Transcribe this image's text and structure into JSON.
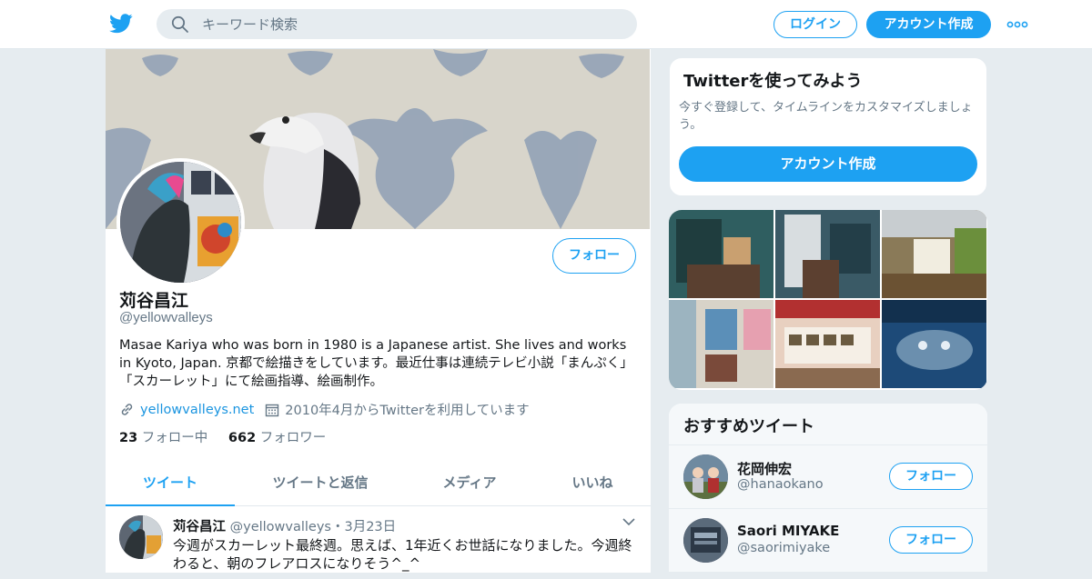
{
  "header": {
    "logo_icon": "twitter-bird-icon",
    "search_placeholder": "キーワード検索",
    "login_label": "ログイン",
    "signup_label": "アカウント作成",
    "more_icon": "more-dots-icon",
    "brand_color": "#1da1f2"
  },
  "profile": {
    "name": "苅谷昌江",
    "handle": "@yellowvalleys",
    "follow_label": "フォロー",
    "bio": "Masae Kariya who was born in 1980 is a Japanese artist. She lives and works in Kyoto, Japan. 京都で絵描きをしています。最近仕事は連続テレビ小説「まんぷく」「スカーレット」にて絵画指導、絵画制作。",
    "website": "yellowvalleys.net",
    "joined": "2010年4月からTwitterを利用しています",
    "following_count": "23",
    "following_label": "フォロー中",
    "followers_count": "662",
    "followers_label": "フォロワー"
  },
  "tabs": [
    {
      "label": "ツイート",
      "active": true
    },
    {
      "label": "ツイートと返信",
      "active": false
    },
    {
      "label": "メディア",
      "active": false
    },
    {
      "label": "いいね",
      "active": false
    }
  ],
  "tweet": {
    "name": "苅谷昌江",
    "handle": "@yellowvalleys",
    "separator": "・",
    "time": "3月23日",
    "text": "今週がスカーレット最終週。思えば、1年近くお世話になりました。今週終わると、朝のフレアロスになりそう^_^"
  },
  "sidebar": {
    "signup_card": {
      "title": "Twitterを使ってみよう",
      "subtitle": "今すぐ登録して、タイムラインをカスタマイズしましょう。",
      "button": "アカウント作成"
    },
    "reco": {
      "title": "おすすめツイート",
      "items": [
        {
          "name": "花岡伸宏",
          "handle": "@hanaokano",
          "follow": "フォロー"
        },
        {
          "name": "Saori MIYAKE",
          "handle": "@saorimiyake",
          "follow": "フォロー"
        }
      ]
    }
  }
}
